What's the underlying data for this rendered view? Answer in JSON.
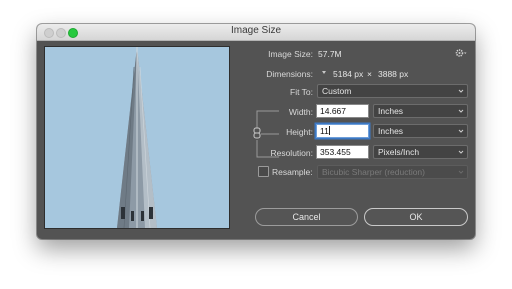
{
  "window": {
    "title": "Image Size"
  },
  "image_size": {
    "label": "Image Size:",
    "value": "57.7M"
  },
  "settings": {
    "icon": "gear-icon"
  },
  "dimensions": {
    "label": "Dimensions:",
    "width": "5184 px",
    "separator": "×",
    "height": "3888 px"
  },
  "fit_to": {
    "label": "Fit To:",
    "selected": "Custom"
  },
  "width": {
    "label": "Width:",
    "value": "14.667",
    "unit": "Inches"
  },
  "height": {
    "label": "Height:",
    "value": "11",
    "unit": "Inches"
  },
  "resolution": {
    "label": "Resolution:",
    "value": "353.455",
    "unit": "Pixels/Inch"
  },
  "resample": {
    "label": "Resample:",
    "checked": false,
    "method": "Bicubic Sharper (reduction)"
  },
  "buttons": {
    "cancel": "Cancel",
    "ok": "OK"
  },
  "colors": {
    "zoom_light": "#27c93f",
    "sky": "#a6c7de",
    "focus": "#3c78c4"
  }
}
